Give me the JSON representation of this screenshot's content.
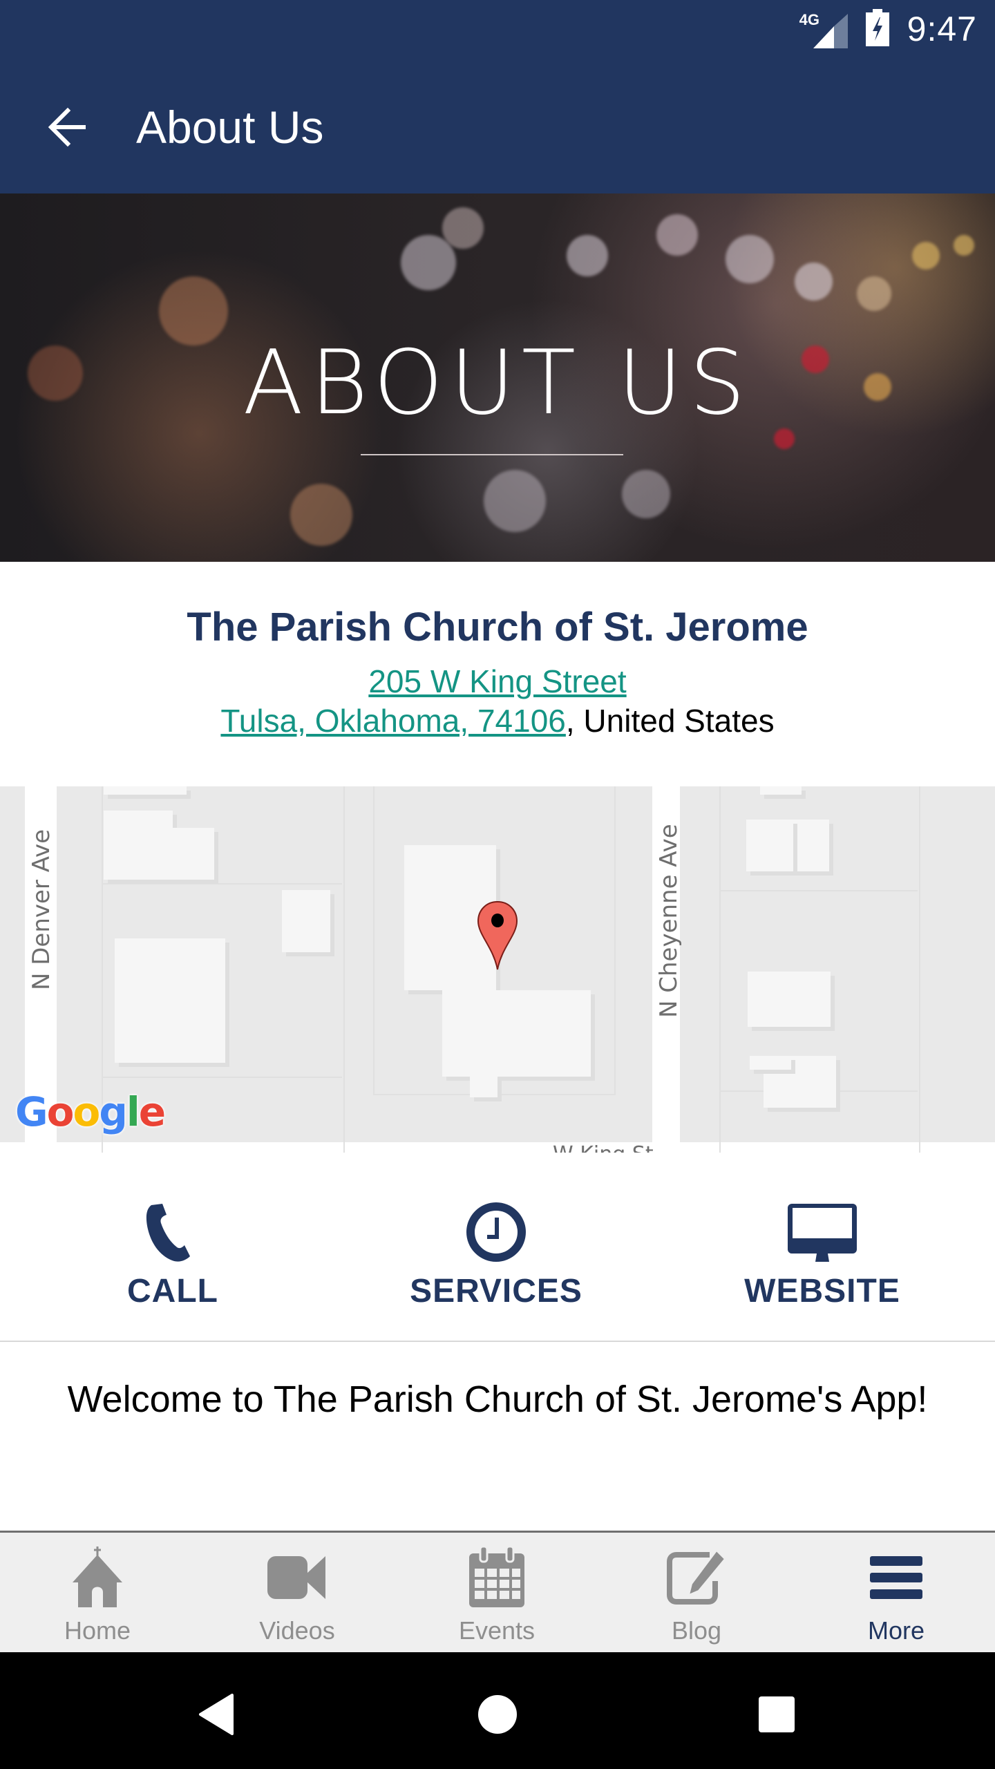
{
  "status_bar": {
    "network": "4G",
    "signal_icon": "cell-signal-icon",
    "battery_icon": "battery-charging-icon",
    "time": "9:47"
  },
  "app_bar": {
    "back_icon": "arrow-back-icon",
    "title": "About Us"
  },
  "banner": {
    "title": "ABOUT US"
  },
  "church": {
    "name": "The Parish Church of St. Jerome",
    "street": "205 W King Street",
    "city_state_zip": "Tulsa, Oklahoma, 74106",
    "country_suffix": ", United States",
    "link_color": "#149484"
  },
  "map": {
    "streets": [
      "N Denver Ave",
      "N Cheyenne Ave",
      "W King St"
    ],
    "provider_logo": "Google",
    "pin_color": "#f0675c"
  },
  "actions": [
    {
      "label": "CALL",
      "icon": "phone-icon"
    },
    {
      "label": "SERVICES",
      "icon": "clock-icon"
    },
    {
      "label": "WEBSITE",
      "icon": "monitor-icon"
    }
  ],
  "welcome_text": "Welcome to The Parish Church of St. Jerome's App!",
  "tabs": [
    {
      "label": "Home",
      "icon": "church-icon",
      "active": false
    },
    {
      "label": "Videos",
      "icon": "video-camera-icon",
      "active": false
    },
    {
      "label": "Events",
      "icon": "calendar-icon",
      "active": false
    },
    {
      "label": "Blog",
      "icon": "edit-icon",
      "active": false
    },
    {
      "label": "More",
      "icon": "menu-icon",
      "active": true
    }
  ],
  "colors": {
    "primary": "#213660",
    "inactive_tab": "#8e8e8e",
    "tab_bar_bg": "#efefef"
  }
}
